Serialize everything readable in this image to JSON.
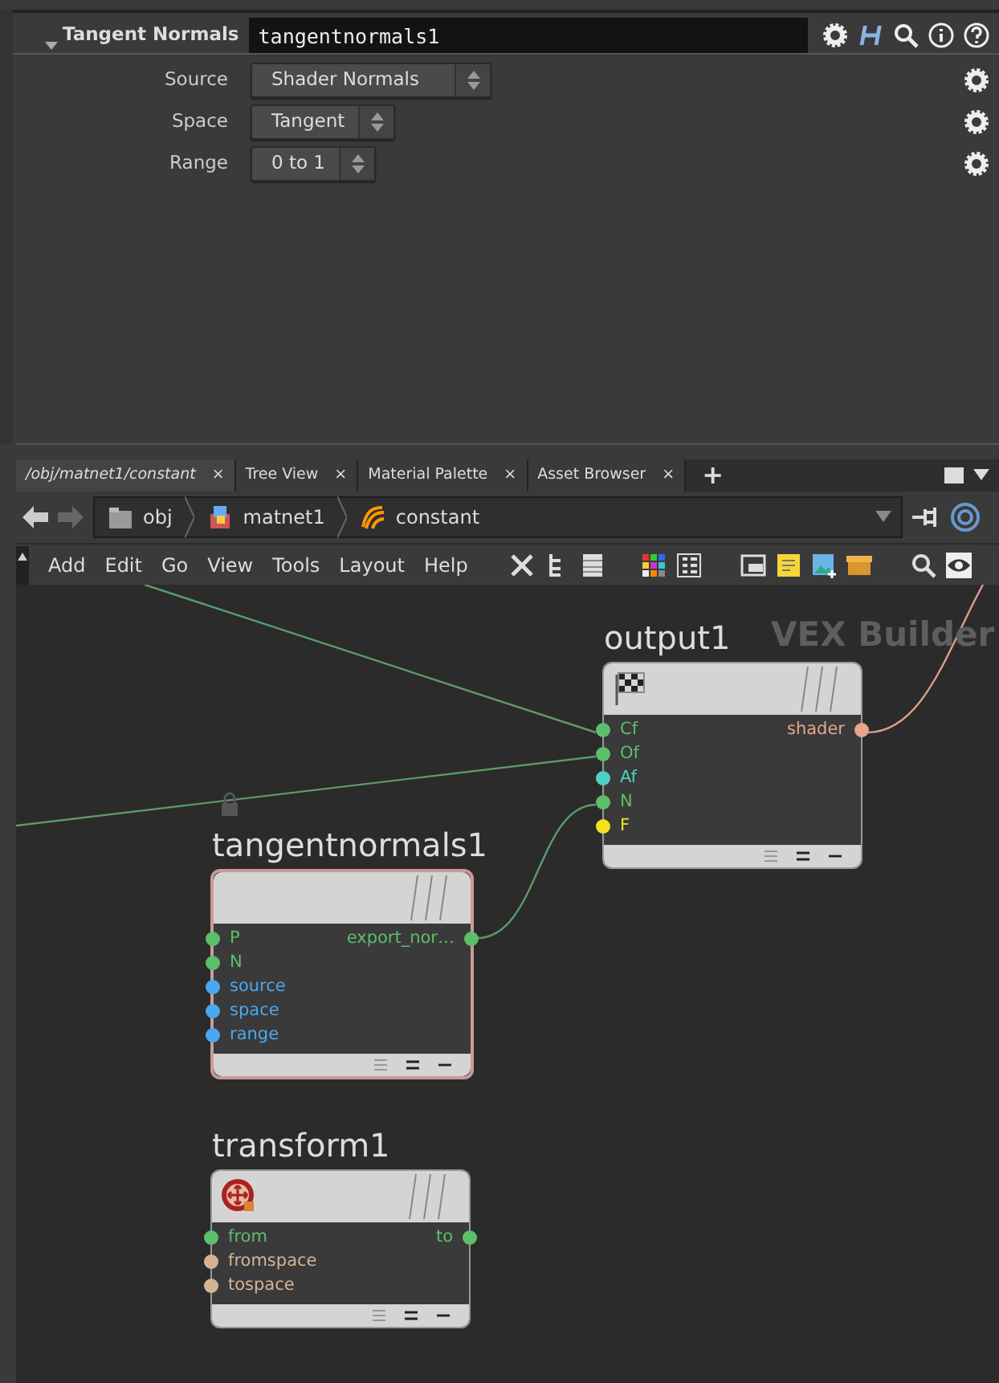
{
  "parameter_pane": {
    "node_type": "Tangent Normals",
    "node_name": "tangentnormals1",
    "parameters": [
      {
        "label": "Source",
        "value": "Shader Normals"
      },
      {
        "label": "Space",
        "value": "Tangent"
      },
      {
        "label": "Range",
        "value": "0 to 1"
      }
    ]
  },
  "pane_tabs": [
    {
      "label": "/obj/matnet1/constant",
      "close": "×",
      "selected": true
    },
    {
      "label": "Tree View",
      "close": "×",
      "selected": false
    },
    {
      "label": "Material Palette",
      "close": "×",
      "selected": false
    },
    {
      "label": "Asset Browser",
      "close": "×",
      "selected": false
    }
  ],
  "new_tab": "+",
  "path": [
    "obj",
    "matnet1",
    "constant"
  ],
  "menu": [
    "Add",
    "Edit",
    "Go",
    "View",
    "Tools",
    "Layout",
    "Help"
  ],
  "network": {
    "watermark": "VEX Builder",
    "nodes": [
      {
        "name": "output1",
        "selected": false,
        "kind": "flag",
        "inputs": [
          {
            "label": "Cf",
            "color": "#5cbf6a"
          },
          {
            "label": "Of",
            "color": "#5cbf6a"
          },
          {
            "label": "Af",
            "color": "#4fd1c5"
          },
          {
            "label": "N",
            "color": "#5cbf6a"
          },
          {
            "label": "F",
            "color": "#f5e11e"
          }
        ],
        "outputs": [
          {
            "label": "shader",
            "color": "#e8a48c"
          }
        ]
      },
      {
        "name": "tangentnormals1",
        "selected": true,
        "kind": "blank",
        "inputs": [
          {
            "label": "P",
            "color": "#5cbf6a"
          },
          {
            "label": "N",
            "color": "#5cbf6a"
          },
          {
            "label": "source",
            "color": "#4aa8f0"
          },
          {
            "label": "space",
            "color": "#4aa8f0"
          },
          {
            "label": "range",
            "color": "#4aa8f0"
          }
        ],
        "outputs": [
          {
            "label": "export_nor…",
            "color": "#5cbf6a"
          }
        ]
      },
      {
        "name": "transform1",
        "selected": false,
        "kind": "transform",
        "inputs": [
          {
            "label": "from",
            "color": "#5cbf6a"
          },
          {
            "label": "fromspace",
            "color": "#d6b394"
          },
          {
            "label": "tospace",
            "color": "#d6b394"
          }
        ],
        "outputs": [
          {
            "label": "to",
            "color": "#5cbf6a"
          }
        ]
      }
    ]
  }
}
